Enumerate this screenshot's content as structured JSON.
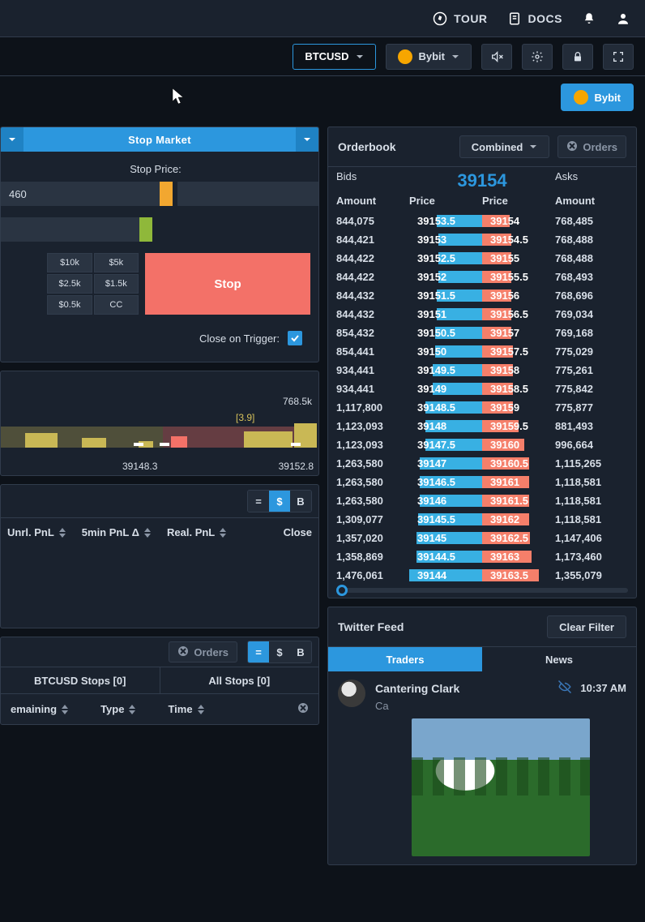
{
  "nav": {
    "tour": "TOUR",
    "docs": "DOCS"
  },
  "toolbar": {
    "pair": "BTCUSD",
    "exchange": "Bybit"
  },
  "subbar": {
    "bybit": "Bybit"
  },
  "order_entry": {
    "tab": "Stop Market",
    "stop_price_label": "Stop Price:",
    "left_value": "460",
    "quick": [
      "$10k",
      "$5k",
      "$2.5k",
      "$1.5k",
      "$0.5k",
      "CC"
    ],
    "submit": "Stop",
    "close_on_trigger": "Close on Trigger:"
  },
  "depth": {
    "right_label": "768.5k",
    "mid_label": "[3.9]",
    "x1": "39148.3",
    "x2": "39152.8"
  },
  "positions": {
    "cols": [
      "Unrl. PnL",
      "5min PnL Δ",
      "Real. PnL",
      "Close"
    ]
  },
  "orders_chip": "Orders",
  "stops": {
    "tab1": "BTCUSD Stops [0]",
    "tab2": "All Stops [0]",
    "cols": [
      "emaining",
      "Type",
      "Time"
    ]
  },
  "orderbook": {
    "title": "Orderbook",
    "mode": "Combined",
    "orders_btn": "Orders",
    "col_group": {
      "bids": "Bids",
      "asks": "Asks"
    },
    "labels": {
      "amount_l": "Amount",
      "price_l": "Price",
      "price_r": "Price",
      "amount_r": "Amount"
    },
    "mid": "39154",
    "rows": [
      {
        "ba": "844,075",
        "bp": "39153.5",
        "ap": "39154",
        "aa": "768,485",
        "bw": 62,
        "aw": 38
      },
      {
        "ba": "844,421",
        "bp": "39153",
        "ap": "39154.5",
        "aa": "768,488",
        "bw": 60,
        "aw": 40
      },
      {
        "ba": "844,422",
        "bp": "39152.5",
        "ap": "39155",
        "aa": "768,488",
        "bw": 60,
        "aw": 40
      },
      {
        "ba": "844,422",
        "bp": "39152",
        "ap": "39155.5",
        "aa": "768,493",
        "bw": 60,
        "aw": 40
      },
      {
        "ba": "844,432",
        "bp": "39151.5",
        "ap": "39156",
        "aa": "768,696",
        "bw": 62,
        "aw": 40
      },
      {
        "ba": "844,432",
        "bp": "39151",
        "ap": "39156.5",
        "aa": "769,034",
        "bw": 62,
        "aw": 40
      },
      {
        "ba": "854,432",
        "bp": "39150.5",
        "ap": "39157",
        "aa": "769,168",
        "bw": 64,
        "aw": 40
      },
      {
        "ba": "854,441",
        "bp": "39150",
        "ap": "39157.5",
        "aa": "775,029",
        "bw": 64,
        "aw": 42
      },
      {
        "ba": "934,441",
        "bp": "39149.5",
        "ap": "39158",
        "aa": "775,261",
        "bw": 68,
        "aw": 42
      },
      {
        "ba": "934,441",
        "bp": "39149",
        "ap": "39158.5",
        "aa": "775,842",
        "bw": 68,
        "aw": 42
      },
      {
        "ba": "1,117,800",
        "bp": "39148.5",
        "ap": "39159",
        "aa": "775,877",
        "bw": 78,
        "aw": 42
      },
      {
        "ba": "1,123,093",
        "bp": "39148",
        "ap": "39159.5",
        "aa": "881,493",
        "bw": 78,
        "aw": 50
      },
      {
        "ba": "1,123,093",
        "bp": "39147.5",
        "ap": "39160",
        "aa": "996,664",
        "bw": 78,
        "aw": 58
      },
      {
        "ba": "1,263,580",
        "bp": "39147",
        "ap": "39160.5",
        "aa": "1,115,265",
        "bw": 86,
        "aw": 64
      },
      {
        "ba": "1,263,580",
        "bp": "39146.5",
        "ap": "39161",
        "aa": "1,118,581",
        "bw": 86,
        "aw": 64
      },
      {
        "ba": "1,263,580",
        "bp": "39146",
        "ap": "39161.5",
        "aa": "1,118,581",
        "bw": 86,
        "aw": 64
      },
      {
        "ba": "1,309,077",
        "bp": "39145.5",
        "ap": "39162",
        "aa": "1,118,581",
        "bw": 88,
        "aw": 64
      },
      {
        "ba": "1,357,020",
        "bp": "39145",
        "ap": "39162.5",
        "aa": "1,147,406",
        "bw": 90,
        "aw": 66
      },
      {
        "ba": "1,358,869",
        "bp": "39144.5",
        "ap": "39163",
        "aa": "1,173,460",
        "bw": 90,
        "aw": 68
      },
      {
        "ba": "1,476,061",
        "bp": "39144",
        "ap": "39163.5",
        "aa": "1,355,079",
        "bw": 100,
        "aw": 78
      }
    ]
  },
  "twitter": {
    "title": "Twitter Feed",
    "clear": "Clear Filter",
    "tabs": {
      "traders": "Traders",
      "news": "News"
    },
    "tweet": {
      "name": "Cantering Clark",
      "text": "Ca",
      "time": "10:37 AM"
    }
  }
}
